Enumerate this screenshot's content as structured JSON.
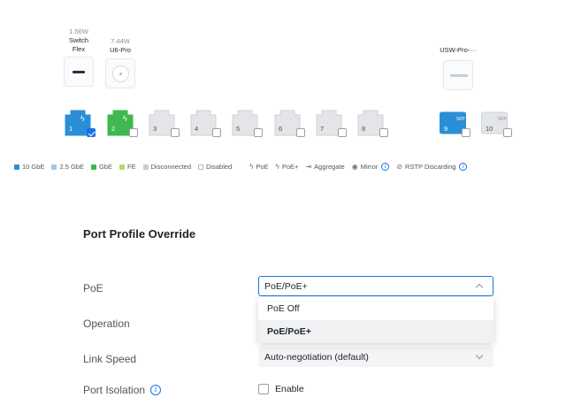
{
  "devices": [
    {
      "power": "1.56W",
      "name_line1": "Switch",
      "name_line2": "Flex"
    },
    {
      "power": "7.44W",
      "name_line1": "U6-Pro",
      "name_line2": ""
    },
    {
      "power": "",
      "name_line1": "USW-Pro-···",
      "name_line2": ""
    }
  ],
  "ports": [
    {
      "num": "1",
      "state": "10gbe",
      "poe": true,
      "checked": true
    },
    {
      "num": "2",
      "state": "gbe",
      "poe": true,
      "checked": false
    },
    {
      "num": "3",
      "state": "disconnected",
      "poe": false,
      "checked": false
    },
    {
      "num": "4",
      "state": "disconnected",
      "poe": false,
      "checked": false
    },
    {
      "num": "5",
      "state": "disconnected",
      "poe": false,
      "checked": false
    },
    {
      "num": "6",
      "state": "disconnected",
      "poe": false,
      "checked": false
    },
    {
      "num": "7",
      "state": "disconnected",
      "poe": false,
      "checked": false
    },
    {
      "num": "8",
      "state": "disconnected",
      "poe": false,
      "checked": false
    },
    {
      "num": "9",
      "state": "10gbe",
      "sfp": "SFP",
      "checked": false
    },
    {
      "num": "10",
      "state": "disconnected",
      "sfp": "SFP",
      "checked": false
    }
  ],
  "colors": {
    "10gbe": "#2a8fd6",
    "2.5gbe": "#9cc9ef",
    "gbe": "#3fb84f",
    "fe": "#b4db6b",
    "disconnected": "#e3e5e8",
    "disabled": "#ffffff",
    "accent": "#1a73e8"
  },
  "legend": {
    "gbe10": "10 GbE",
    "gbe25": "2.5 GbE",
    "gbe": "GbE",
    "fe": "FE",
    "disconnected": "Disconnected",
    "disabled": "Disabled",
    "poe": "PoE",
    "poeplus": "PoE+",
    "aggregate": "Aggregate",
    "mirror": "Mirror",
    "rstp": "RSTP Discarding",
    "info": "i"
  },
  "form": {
    "title": "Port Profile Override",
    "poe_label": "PoE",
    "poe_value": "PoE/PoE+",
    "poe_options": [
      "PoE Off",
      "PoE/PoE+"
    ],
    "operation_label": "Operation",
    "link_speed_label": "Link Speed",
    "link_speed_value": "Auto-negotiation (default)",
    "isolation_label": "Port Isolation",
    "isolation_checkbox": "Enable",
    "info": "i"
  }
}
